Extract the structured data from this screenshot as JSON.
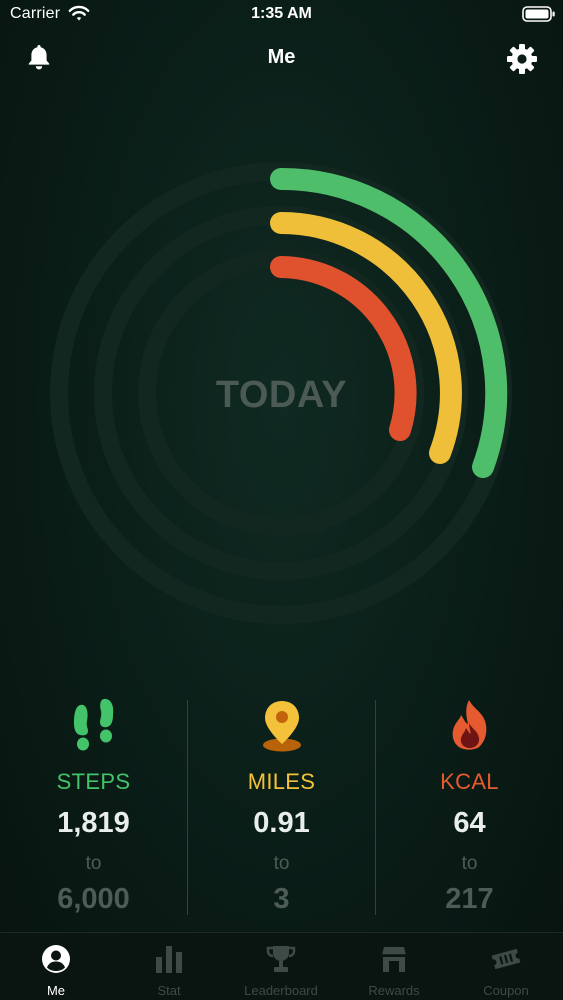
{
  "status_bar": {
    "carrier": "Carrier",
    "time": "1:35 AM"
  },
  "nav": {
    "title": "Me"
  },
  "ring": {
    "center_label": "TODAY",
    "colors": {
      "steps": "#4fbe6a",
      "miles": "#f0bf3a",
      "kcal": "#e0512e",
      "track": "#14281f"
    }
  },
  "stats": [
    {
      "label": "STEPS",
      "value": "1,819",
      "to": "to",
      "goal": "6,000",
      "color": "#43c36a",
      "icon": "footprints-icon"
    },
    {
      "label": "MILES",
      "value": "0.91",
      "to": "to",
      "goal": "3",
      "color": "#f3c23a",
      "icon": "location-pin-icon"
    },
    {
      "label": "KCAL",
      "value": "64",
      "to": "to",
      "goal": "217",
      "color": "#e55a2f",
      "icon": "flame-icon"
    }
  ],
  "tab_bar": {
    "tabs": [
      {
        "label": "Me",
        "icon": "person-icon",
        "active": true
      },
      {
        "label": "Stat",
        "icon": "bar-chart-icon",
        "active": false
      },
      {
        "label": "Leaderboard",
        "icon": "trophy-icon",
        "active": false
      },
      {
        "label": "Rewards",
        "icon": "gift-icon",
        "active": false
      },
      {
        "label": "Coupon",
        "icon": "ticket-icon",
        "active": false
      }
    ]
  }
}
